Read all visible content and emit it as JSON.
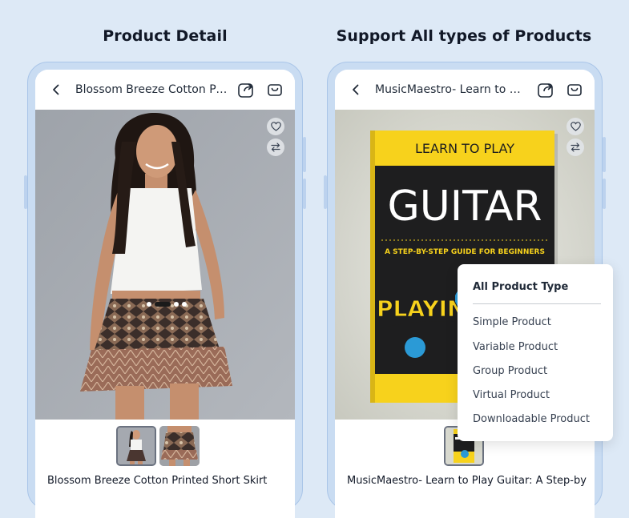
{
  "headings": {
    "left": "Product Detail",
    "right": "Support All types of Products"
  },
  "left_phone": {
    "title": "Blossom Breeze Cotton Print...",
    "product_name": "Blossom Breeze Cotton Printed Short Skirt",
    "image_dots": {
      "count": 4,
      "active": 1
    },
    "thumbnails": 2
  },
  "right_phone": {
    "title": "MusicMaestro- Learn to Play ...",
    "product_name": "MusicMaestro- Learn to Play Guitar: A Step-by",
    "book": {
      "top_text": "LEARN TO PLAY",
      "main_text": "GUITAR",
      "subtitle": "A STEP-BY-STEP GUIDE FOR BEGINNERS",
      "art_text": "PLAYIN"
    },
    "thumbnails": 1
  },
  "dropdown": {
    "title": "All Product Type",
    "items": [
      "Simple Product",
      "Variable Product",
      "Group Product",
      "Virtual Product",
      "Downloadable Product"
    ]
  },
  "icons": {
    "back": "chevron-left-icon",
    "share": "share-icon",
    "cart": "shopping-bag-icon",
    "wishlist": "heart-icon",
    "compare": "compare-arrows-icon"
  },
  "colors": {
    "background": "#dde9f6",
    "phone_frame": "#c9dcf2",
    "book_yellow": "#f7d21c",
    "book_dark": "#1e1e1f",
    "guitar_blue": "#2b9ad6"
  }
}
